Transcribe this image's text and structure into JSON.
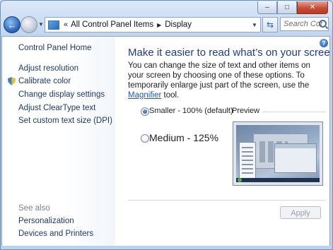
{
  "window": {
    "caption_minimize_glyph": "–",
    "caption_maximize_glyph": "□",
    "caption_close_glyph": "✕"
  },
  "nav": {
    "back_glyph": "←",
    "forward_glyph": "→",
    "dropdown_glyph": "▼",
    "address_chevron": "«",
    "breadcrumbs": [
      "All Control Panel Items",
      "Display"
    ],
    "breadcrumb_separator": "▶",
    "refresh_glyph": "⇆",
    "search_placeholder": "Search Control ..."
  },
  "help_glyph": "?",
  "sidebar": {
    "home": "Control Panel Home",
    "tasks": [
      "Adjust resolution",
      "Calibrate color",
      "Change display settings",
      "Adjust ClearType text",
      "Set custom text size (DPI)"
    ],
    "see_also_heading": "See also",
    "see_also": [
      "Personalization",
      "Devices and Printers"
    ]
  },
  "main": {
    "title": "Make it easier to read what’s on your screen",
    "description_before_link": "You can change the size of text and other items on your screen by choosing one of these options. To temporarily enlarge just part of the screen, use the ",
    "description_link": "Magnifier",
    "description_after_link": " tool.",
    "options": [
      {
        "label": "Smaller - 100% (default)",
        "selected": true
      },
      {
        "label": "Medium - 125%",
        "selected": false
      }
    ],
    "preview_label": "Preview",
    "apply_label": "Apply",
    "apply_enabled": false
  },
  "colors": {
    "accent_link": "#1e5ab4",
    "title_blue": "#1e3e80",
    "frame": "#bcd2ec",
    "close_red": "#c94c35"
  },
  "icons": {
    "calibrate": "uac-shield-icon",
    "address": "control-panel-icon",
    "search": "magnifier-icon"
  }
}
